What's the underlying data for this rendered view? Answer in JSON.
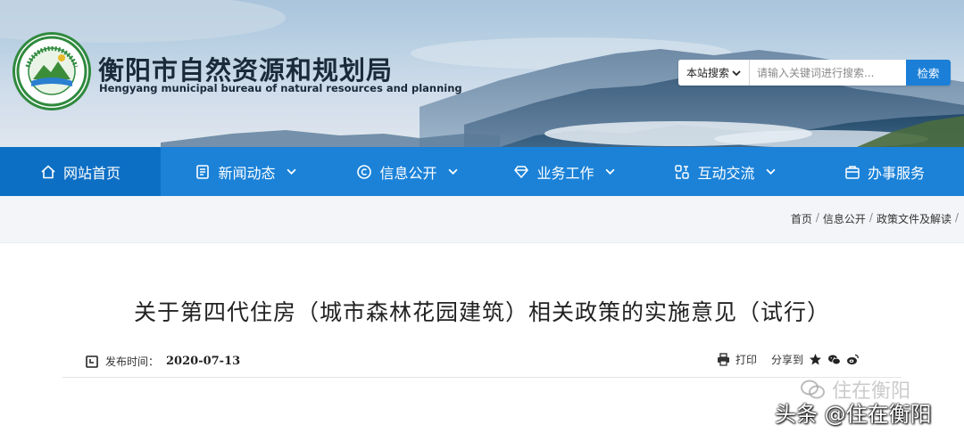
{
  "header": {
    "site_title": "衡阳市自然资源和规划局",
    "site_subtitle": "Hengyang municipal bureau of natural resources and planning",
    "logo_text": "衡阳市自然资源和规划局 Hengyang municipal bureau of natural resources and planning",
    "search": {
      "scope_label": "本站搜索",
      "placeholder": "请输入关键词进行搜索...",
      "button_label": "检索"
    }
  },
  "nav": {
    "items": [
      {
        "label": "网站首页",
        "icon": "home-icon",
        "active": true
      },
      {
        "label": "新闻动态",
        "icon": "document-icon",
        "dropdown": true
      },
      {
        "label": "信息公开",
        "icon": "copyright-icon",
        "dropdown": true
      },
      {
        "label": "业务工作",
        "icon": "diamond-icon",
        "dropdown": true
      },
      {
        "label": "互动交流",
        "icon": "interaction-icon",
        "dropdown": true
      },
      {
        "label": "办事服务",
        "icon": "service-icon",
        "dropdown": false
      }
    ]
  },
  "breadcrumb": {
    "items": [
      "首页",
      "信息公开",
      "政策文件及解读"
    ],
    "separator": "/"
  },
  "article": {
    "title": "关于第四代住房（城市森林花园建筑）相关政策的实施意见（试行）",
    "publish_label": "发布时间：",
    "publish_date": "2020-07-13",
    "print_label": "打印",
    "share_label": "分享到"
  },
  "watermark": {
    "line1": "住在衡阳",
    "line2": "头条 @住在衡阳"
  },
  "colors": {
    "nav_bg": "#1b82d8",
    "nav_active": "#0d6fc4",
    "search_button": "#1b7fd8"
  }
}
